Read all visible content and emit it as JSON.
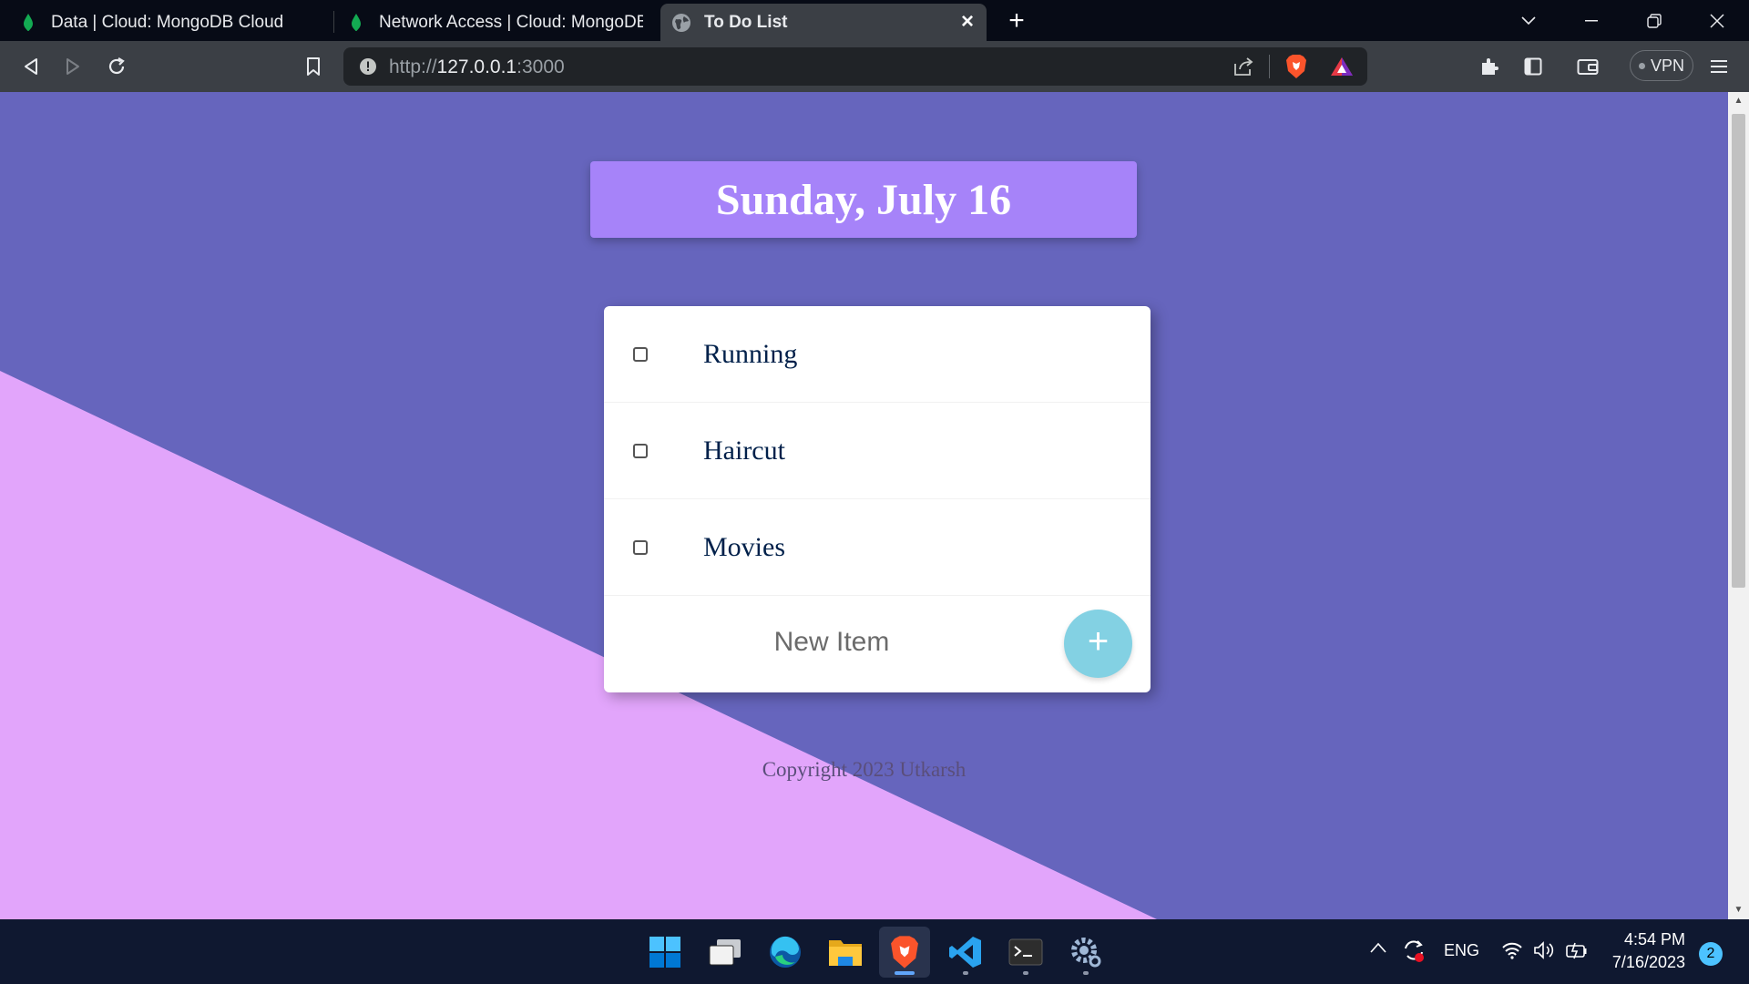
{
  "browser": {
    "tabs": [
      {
        "title": "Data | Cloud: MongoDB Cloud",
        "icon": "mongodb-leaf-icon"
      },
      {
        "title": "Network Access | Cloud: MongoDB Cloud",
        "icon": "mongodb-leaf-icon"
      },
      {
        "title": "To Do List",
        "icon": "globe-icon",
        "active": true
      }
    ],
    "url_scheme": "http://",
    "url_host": "127.0.0.1",
    "url_port": ":3000",
    "vpn_label": "VPN"
  },
  "page": {
    "heading": "Sunday, July 16",
    "items": [
      {
        "label": "Running",
        "checked": false
      },
      {
        "label": "Haircut",
        "checked": false
      },
      {
        "label": "Movies",
        "checked": false
      }
    ],
    "new_item_placeholder": "New Item",
    "add_button_label": "+",
    "footer": "Copyright 2023 Utkarsh",
    "colors": {
      "background": "#6665bd",
      "triangle": "#e2a5fb",
      "heading_box": "#a683f9",
      "add_button": "#83d1e3",
      "item_text": "#00204a"
    }
  },
  "taskbar": {
    "apps": [
      "windows-start-icon",
      "task-view-icon",
      "edge-icon",
      "file-explorer-icon",
      "brave-icon",
      "vscode-icon",
      "terminal-icon",
      "settings-icon"
    ],
    "language": "ENG",
    "time": "4:54 PM",
    "date": "7/16/2023",
    "notifications": "2"
  }
}
